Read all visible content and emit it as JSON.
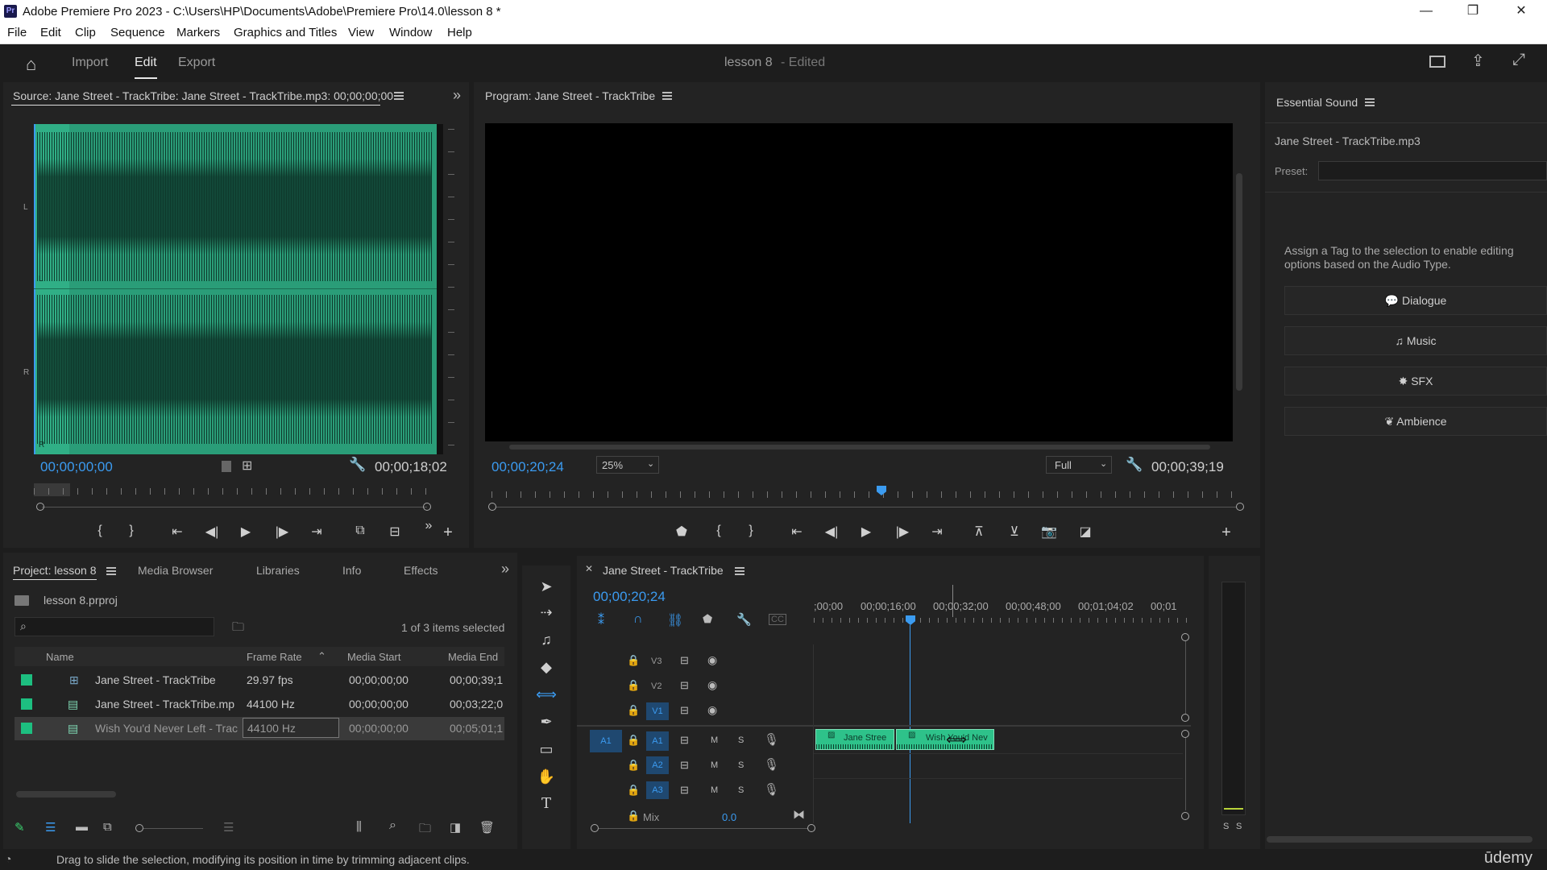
{
  "app": {
    "title": "Adobe Premiere Pro 2023 - C:\\Users\\HP\\Documents\\Adobe\\Premiere Pro\\14.0\\lesson 8 *",
    "logo": "Pr"
  },
  "window_controls": {
    "minimize": "—",
    "restore": "❐",
    "close": "✕"
  },
  "menu": [
    "File",
    "Edit",
    "Clip",
    "Sequence",
    "Markers",
    "Graphics and Titles",
    "View",
    "Window",
    "Help"
  ],
  "header": {
    "tabs": [
      "Import",
      "Edit",
      "Export"
    ],
    "active_tab": "Edit",
    "project_name": "lesson 8",
    "project_status": "- Edited"
  },
  "source": {
    "title": "Source: Jane Street - TrackTribe: Jane Street - TrackTribe.mp3: 00;00;00;00",
    "timecode_in": "00;00;00;00",
    "duration": "00;00;18;02",
    "channel_labels": [
      "L",
      "L",
      "R",
      "R"
    ],
    "waveform_color": "#2a9d78"
  },
  "program": {
    "title": "Program: Jane Street - TrackTribe",
    "timecode": "00;00;20;24",
    "zoom": "25%",
    "quality": "Full",
    "duration": "00;00;39;19"
  },
  "essential_sound": {
    "title": "Essential Sound",
    "clip_name": "Jane Street - TrackTribe.mp3",
    "preset_label": "Preset:",
    "hint": "Assign a Tag to the selection to enable editing options based on the Audio Type.",
    "buttons": [
      {
        "label": "Dialogue",
        "icon": "speech-bubble-icon",
        "glyph": "💬"
      },
      {
        "label": "Music",
        "icon": "music-note-icon",
        "glyph": "♫"
      },
      {
        "label": "SFX",
        "icon": "burst-icon",
        "glyph": "✸"
      },
      {
        "label": "Ambience",
        "icon": "leaf-icon",
        "glyph": "❦"
      }
    ]
  },
  "project": {
    "tabs": [
      "Project: lesson 8",
      "Media Browser",
      "Libraries",
      "Info",
      "Effects"
    ],
    "file": "lesson 8.prproj",
    "selection_status": "1 of 3 items selected",
    "columns": [
      "Name",
      "Frame Rate",
      "Media Start",
      "Media End"
    ],
    "rows": [
      {
        "name": "Jane Street - TrackTribe",
        "frame_rate": "29.97 fps",
        "media_start": "00;00;00;00",
        "media_end": "00;00;39;1",
        "type": "sequence"
      },
      {
        "name": "Jane Street - TrackTribe.mp",
        "frame_rate": "44100 Hz",
        "media_start": "00;00;00;00",
        "media_end": "00;03;22;0",
        "type": "audio"
      },
      {
        "name": "Wish You'd Never Left - Trac",
        "frame_rate": "44100 Hz",
        "media_start": "00;00;00;00",
        "media_end": "00;05;01;1",
        "type": "audio",
        "selected": true
      }
    ]
  },
  "timeline": {
    "title": "Jane Street - TrackTribe",
    "timecode": "00;00;20;24",
    "ruler": ";00;00",
    "ruler_labels": [
      ";00;00",
      "00;00;16;00",
      "00;00;32;00",
      "00;00;48;00",
      "00;01;04;02",
      "00;01"
    ],
    "video_tracks": [
      "V3",
      "V2",
      "V1"
    ],
    "audio_tracks": [
      "A1",
      "A2",
      "A3"
    ],
    "source_patch": "A1",
    "mute": "M",
    "solo": "S",
    "mix_label": "Mix",
    "mix_value": "0.0",
    "clips": [
      {
        "label": "Jane Stree"
      },
      {
        "label": "Wish You'd Nev"
      }
    ],
    "meter_labels": [
      "S",
      "S"
    ]
  },
  "status_bar": {
    "message": "Drag to slide the selection, modifying its position in time by trimming adjacent clips.",
    "watermark": "ūdemy"
  }
}
